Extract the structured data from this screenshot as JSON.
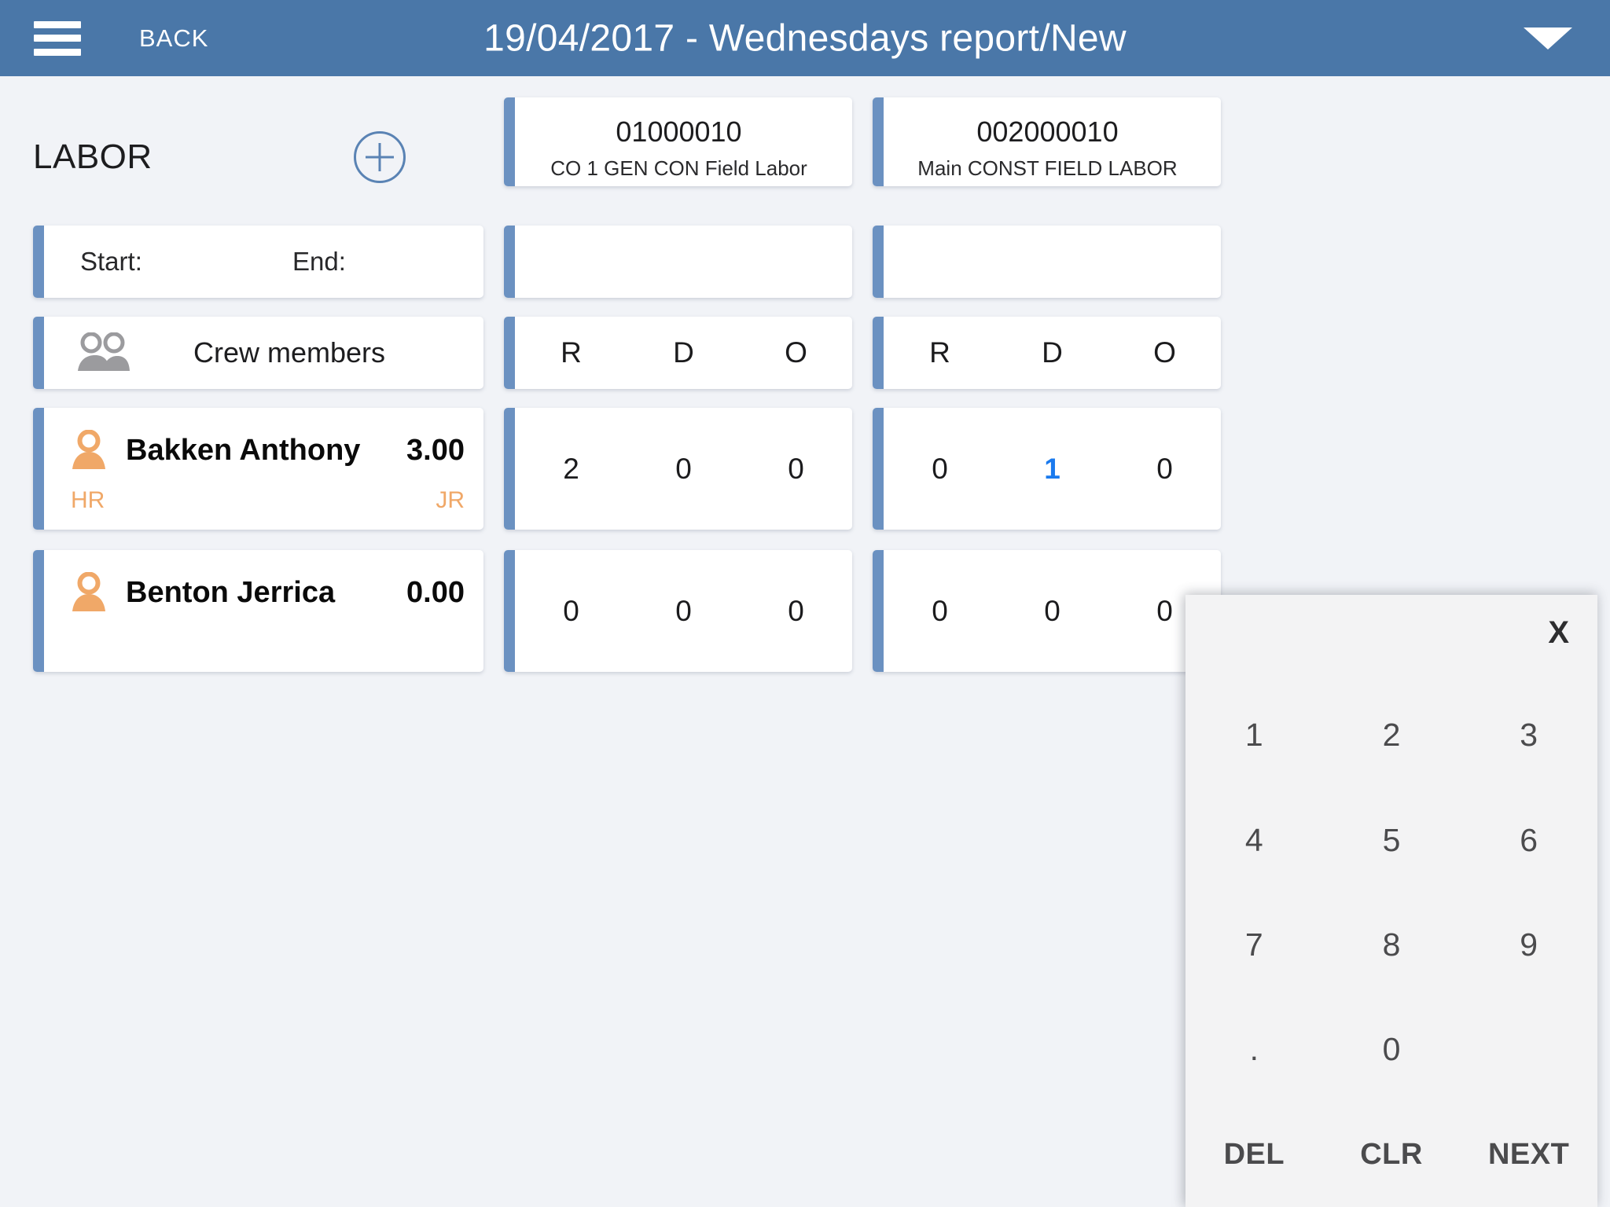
{
  "header": {
    "menu_icon": "hamburger-icon",
    "back_label": "BACK",
    "title": "19/04/2017 - Wednesdays report/New",
    "caret_icon": "chevron-down-icon"
  },
  "section": {
    "title": "LABOR",
    "add_icon": "plus-circle-icon"
  },
  "jobs": [
    {
      "code": "01000010",
      "desc": "CO 1 GEN CON Field Labor"
    },
    {
      "code": "002000010",
      "desc": "Main CONST FIELD LABOR"
    }
  ],
  "timerow": {
    "start_label": "Start:",
    "end_label": "End:",
    "start_value": "",
    "end_value": ""
  },
  "crew": {
    "icon": "people-icon",
    "label": "Crew members",
    "column_headers": [
      "R",
      "D",
      "O"
    ]
  },
  "workers": [
    {
      "icon": "person-icon",
      "name": "Bakken Anthony",
      "hours": "3.00",
      "sub_left": "HR",
      "sub_right": "JR",
      "values": [
        [
          "2",
          "0",
          "0"
        ],
        [
          "0",
          "1",
          "0"
        ]
      ],
      "active_cell": {
        "job": 1,
        "col": 1
      }
    },
    {
      "icon": "person-icon",
      "name": "Benton Jerrica",
      "hours": "0.00",
      "sub_left": "",
      "sub_right": "",
      "values": [
        [
          "0",
          "0",
          "0"
        ],
        [
          "0",
          "0",
          "0"
        ]
      ],
      "active_cell": null
    }
  ],
  "keypad": {
    "close_label": "X",
    "keys": [
      "1",
      "2",
      "3",
      "4",
      "5",
      "6",
      "7",
      "8",
      "9",
      ".",
      "0",
      "",
      "DEL",
      "CLR",
      "NEXT"
    ],
    "fn_keys": [
      "DEL",
      "CLR",
      "NEXT"
    ]
  },
  "colors": {
    "header_bg": "#4a77a8",
    "page_bg": "#f1f3f7",
    "card_accent": "#6b91c1",
    "person_icon": "#f0a868",
    "active_value": "#1a7aee",
    "keypad_bg": "#f3f3f4"
  }
}
